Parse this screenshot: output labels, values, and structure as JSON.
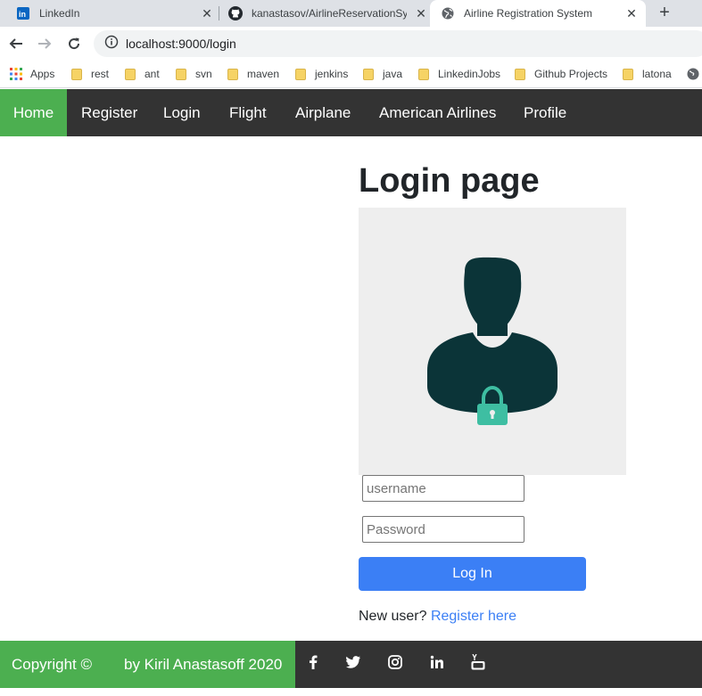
{
  "browser": {
    "tabs": [
      {
        "title": "LinkedIn",
        "icon": "linkedin-icon",
        "active": false
      },
      {
        "title": "kanastasov/AirlineReservationSys",
        "icon": "github-icon",
        "active": false
      },
      {
        "title": "Airline Registration System",
        "icon": "globe-icon",
        "active": true
      }
    ],
    "url": "localhost:9000/login",
    "bookmarks": [
      "Apps",
      "rest",
      "ant",
      "svn",
      "maven",
      "jenkins",
      "java",
      "LinkedinJobs",
      "Github Projects",
      "latona"
    ]
  },
  "navbar": {
    "items": [
      "Home",
      "Register",
      "Login",
      "Flight",
      "Airplane",
      "American Airlines",
      "Profile"
    ],
    "active": "Home",
    "active_color": "#4caf50",
    "bg_color": "#333333"
  },
  "login": {
    "title": "Login page",
    "username_placeholder": "username",
    "password_placeholder": "Password",
    "submit_label": "Log In",
    "new_user_text": "New user?",
    "register_link": "Register here",
    "button_color": "#3b7ff5"
  },
  "footer": {
    "copyright": "Copyright ©",
    "author": "by Kiril Anastasoff 2020",
    "social_icons": [
      "facebook-icon",
      "twitter-icon",
      "instagram-icon",
      "linkedin-icon",
      "youtube-icon"
    ]
  }
}
